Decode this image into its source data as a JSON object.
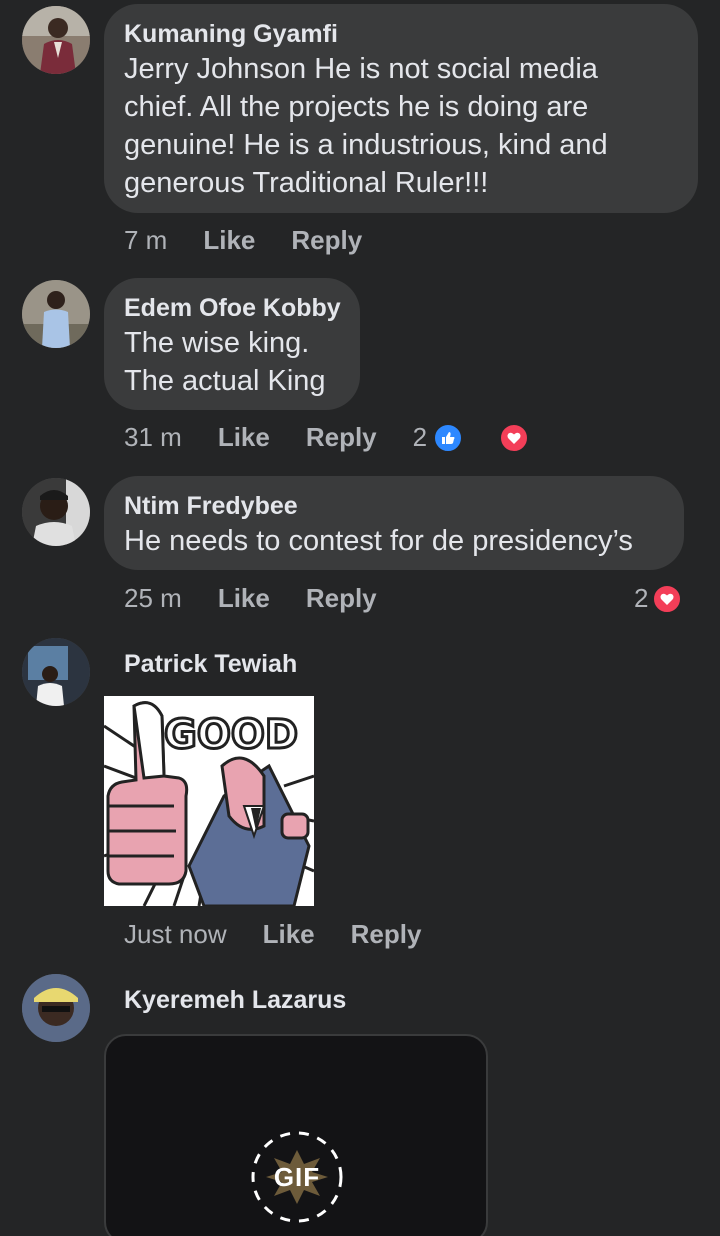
{
  "comments": [
    {
      "author": "Kumaning Gyamfi",
      "text": "Jerry Johnson He is not social media\nchief. All the projects he is doing are\ngenuine! He is a industrious, kind and\ngenerous Traditional Ruler!!!",
      "time": "7 m",
      "like_label": "Like",
      "reply_label": "Reply"
    },
    {
      "author": "Edem Ofoe Kobby",
      "text": "The wise king.\nThe actual King",
      "time": "31 m",
      "like_label": "Like",
      "reply_label": "Reply",
      "reaction_count": "2",
      "reactions": [
        "like-icon",
        "love-icon"
      ]
    },
    {
      "author": "Ntim Fredybee",
      "text": "He needs to contest for de presidency’s",
      "time": "25 m",
      "like_label": "Like",
      "reply_label": "Reply",
      "reaction_count": "2",
      "reactions": [
        "love-icon"
      ]
    },
    {
      "author": "Patrick Tewiah",
      "sticker_text": "GOOD",
      "time": "Just now",
      "like_label": "Like",
      "reply_label": "Reply"
    },
    {
      "author": "Kyeremeh Lazarus",
      "gif_label": "GIF"
    }
  ],
  "colors": {
    "background": "#242526",
    "bubble": "#3a3b3c",
    "text": "#e4e6eb",
    "secondary_text": "#b0b3b8",
    "like_blue": "#2d88ff",
    "love_red": "#f33e58"
  }
}
